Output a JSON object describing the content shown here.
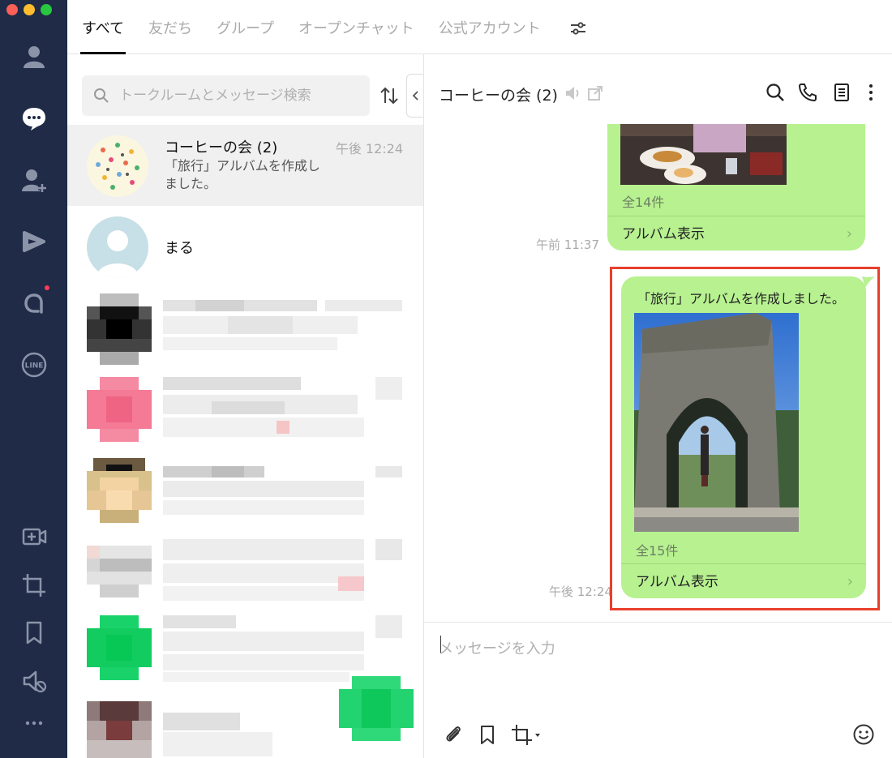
{
  "tabs": [
    {
      "label": "すべて",
      "active": true
    },
    {
      "label": "友だち",
      "active": false
    },
    {
      "label": "グループ",
      "active": false
    },
    {
      "label": "オープンチャット",
      "active": false
    },
    {
      "label": "公式アカウント",
      "active": false
    }
  ],
  "rail": {
    "icons": [
      "person-icon",
      "chat-bubble-icon",
      "add-friend-icon",
      "voom-icon",
      "openchat-icon",
      "line-logo-icon",
      "video-call-icon",
      "crop-icon",
      "bookmark-icon",
      "mute-icon",
      "more-icon"
    ],
    "line_logo_text": "LINE"
  },
  "search": {
    "placeholder": "トークルームとメッセージ検索"
  },
  "chats": [
    {
      "name": "コーヒーの会 (2)",
      "time": "午後 12:24",
      "preview": "「旅行」アルバムを作成しました。",
      "selected": true
    },
    {
      "name": "まる",
      "time": "",
      "preview": "",
      "selected": false
    }
  ],
  "conversation": {
    "title": "コーヒーの会 (2)",
    "messages": [
      {
        "count": "全14件",
        "link": "アルバム表示",
        "time": "午前 11:37"
      },
      {
        "text": "「旅行」アルバムを作成しました。",
        "count": "全15件",
        "link": "アルバム表示",
        "time": "午後 12:24"
      }
    ]
  },
  "composer": {
    "placeholder": "メッセージを入力"
  },
  "colors": {
    "rail_bg": "#1f2b47",
    "bubble": "#b7f190",
    "highlight": "#e8402b"
  }
}
